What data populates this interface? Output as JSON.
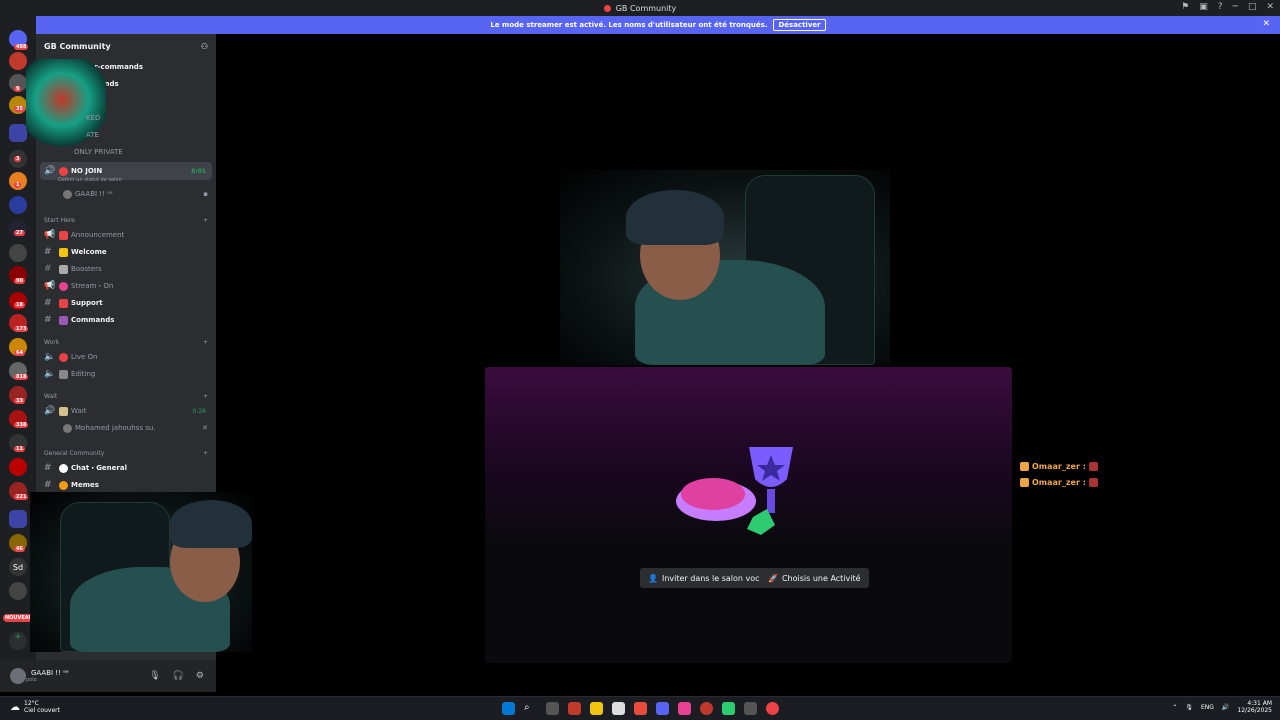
{
  "window": {
    "title": "GB Community"
  },
  "banner": {
    "text": "Le mode streamer est activé. Les noms d'utilisateur ont été tronqués.",
    "button": "Désactiver"
  },
  "rail": {
    "badges": [
      "488",
      "9",
      "35",
      "3",
      "1",
      "27",
      "90",
      "18",
      "173",
      "64",
      "818",
      "33",
      "338",
      "11",
      "221",
      "46"
    ],
    "nouveau": "NOUVEAU",
    "sd_label": "Sd"
  },
  "guild": {
    "name": "GB Community"
  },
  "channels": {
    "moderator": "moderator-commands",
    "bots": "bots-commands",
    "locked": "KED",
    "unlocked_partial": "ATE",
    "only_private": "ONLY PRIVATE",
    "no_join": "NO JOIN",
    "no_join_time": "6:01",
    "no_join_status": "Définir un statut de salon",
    "no_join_member": "GAABI !! ᵃᵃ",
    "start_here": "Start Here",
    "announcement": "Announcement",
    "welcome": "Welcome",
    "boosters": "Boosters",
    "stream_on": "Stream・On",
    "support": "Support",
    "commands": "Commands",
    "work": "Work",
    "live_on": "Live On",
    "editing": "Editing",
    "wait_cat": "Wait",
    "wait": "Wait",
    "wait_time": "0:26",
    "wait_member": "Mohamed jahouhss su.",
    "general_cat": "General Community",
    "chat_general": "Chat・General",
    "memes": "Memes"
  },
  "user": {
    "name": "GAABI !! ᵃᵃ",
    "status": "polo"
  },
  "stage": {
    "invite": "Inviter dans le salon vocal",
    "activity": "Choisis une Activité"
  },
  "overlay": {
    "names": [
      "Omaar_zer :",
      "Omaar_zer :"
    ]
  },
  "taskbar": {
    "temp": "12°C",
    "weather": "Ciel couvert",
    "lang": "ENG",
    "time": "4:31 AM",
    "date": "12/26/2025"
  }
}
